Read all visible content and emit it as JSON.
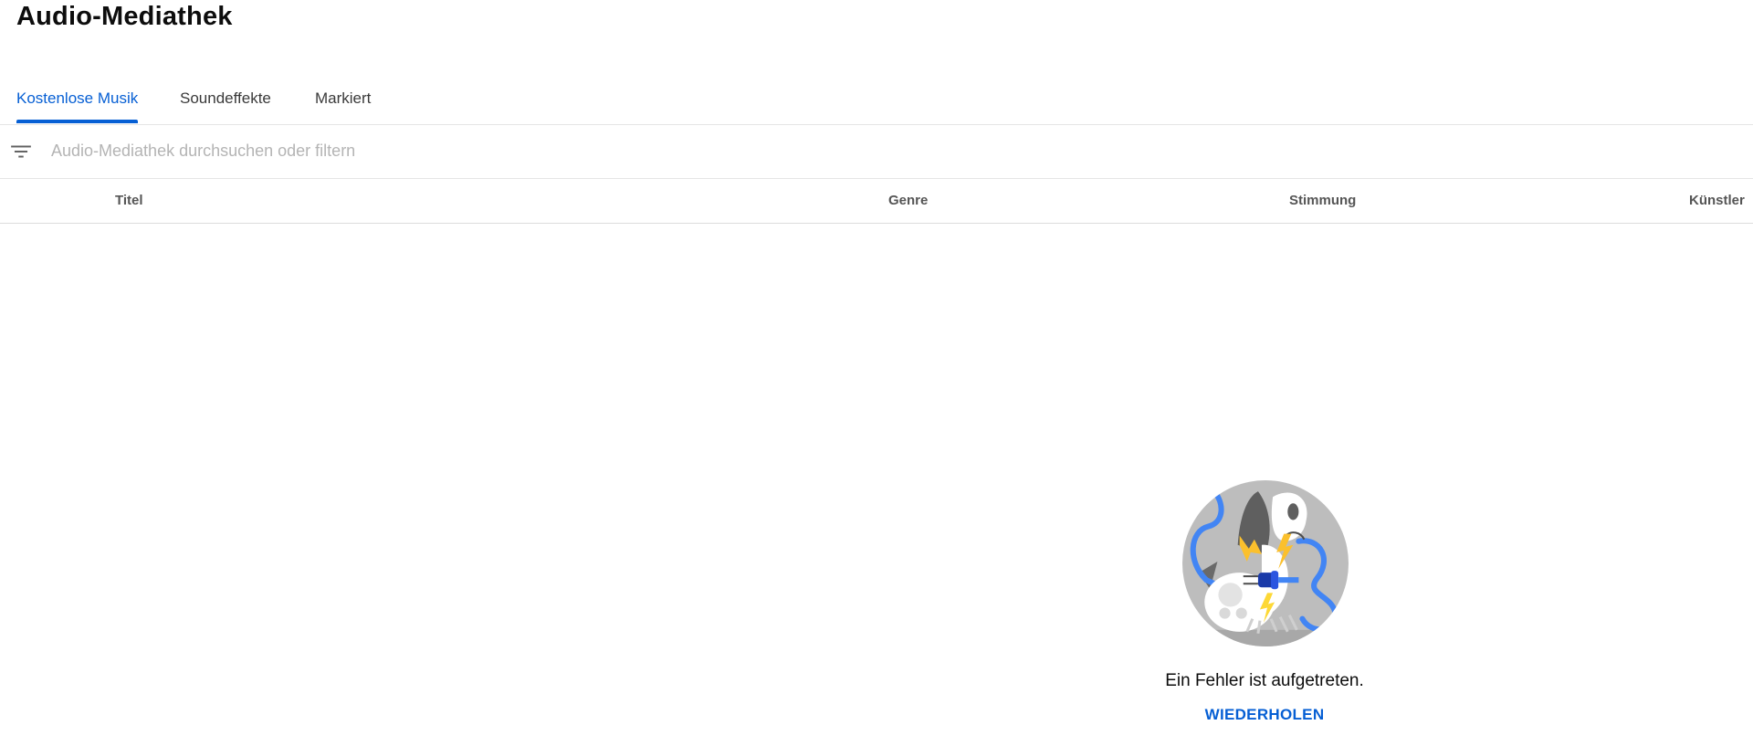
{
  "header": {
    "title": "Audio-Mediathek"
  },
  "tabs": [
    {
      "label": "Kostenlose Musik",
      "active": true
    },
    {
      "label": "Soundeffekte",
      "active": false
    },
    {
      "label": "Markiert",
      "active": false
    }
  ],
  "search": {
    "placeholder": "Audio-Mediathek durchsuchen oder filtern",
    "value": "",
    "icon": "filter-icon"
  },
  "table": {
    "columns": [
      "Titel",
      "Genre",
      "Stimmung",
      "Künstler"
    ]
  },
  "error": {
    "illustration": "unplugged-robot-dog-illustration",
    "message": "Ein Fehler ist aufgetreten.",
    "retry_label": "WIEDERHOLEN"
  },
  "colors": {
    "accent": "#065fd4",
    "text": "#0d0d0d",
    "muted": "#555555",
    "divider": "#e5e5e5"
  }
}
